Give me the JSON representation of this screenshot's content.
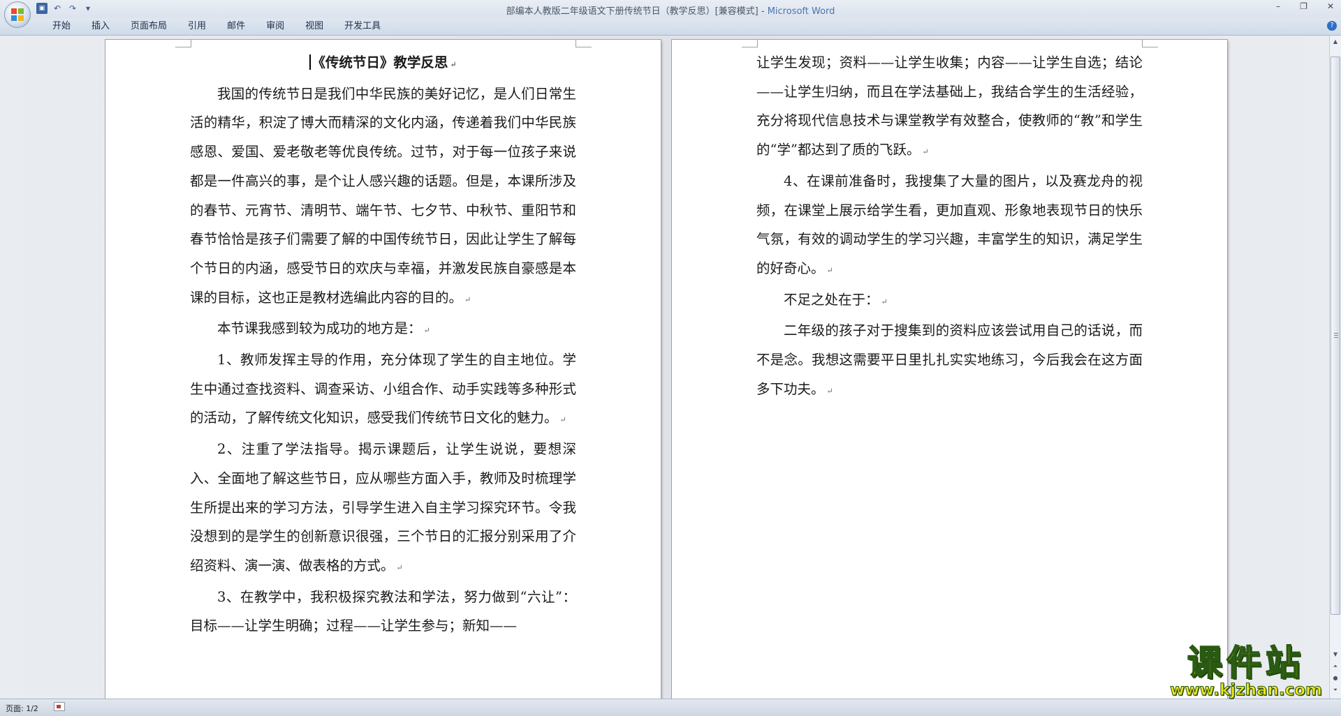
{
  "window": {
    "title_doc": "部编本人教版二年级语文下册传统节日（教学反思）[兼容模式]",
    "title_sep": " - ",
    "title_app": "Microsoft Word",
    "ctrl_min": "–",
    "ctrl_max": "❐",
    "ctrl_close": "✕"
  },
  "quick_access": {
    "save_icon": "save-icon",
    "undo_icon": "undo-icon",
    "redo_icon": "redo-icon",
    "customize_icon": "customize-icon"
  },
  "ribbon": {
    "tabs": [
      "开始",
      "插入",
      "页面布局",
      "引用",
      "邮件",
      "审阅",
      "视图",
      "开发工具"
    ],
    "help": "?"
  },
  "document": {
    "title": "《传统节日》教学反思",
    "page1_paragraphs": [
      "我国的传统节日是我们中华民族的美好记忆，是人们日常生活的精华，积淀了博大而精深的文化内涵，传递着我们中华民族感恩、爱国、爱老敬老等优良传统。过节，对于每一位孩子来说都是一件高兴的事，是个让人感兴趣的话题。但是，本课所涉及的春节、元宵节、清明节、端午节、七夕节、中秋节、重阳节和春节恰恰是孩子们需要了解的中国传统节日，因此让学生了解每个节日的内涵，感受节日的欢庆与幸福，并激发民族自豪感是本课的目标，这也正是教材选编此内容的目的。",
      "本节课我感到较为成功的地方是：",
      "1、教师发挥主导的作用，充分体现了学生的自主地位。学生中通过查找资料、调查采访、小组合作、动手实践等多种形式的活动，了解传统文化知识，感受我们传统节日文化的魅力。",
      "2、注重了学法指导。揭示课题后，让学生说说，要想深入、全面地了解这些节日，应从哪些方面入手，教师及时梳理学生所提出来的学习方法，引导学生进入自主学习探究环节。令我没想到的是学生的创新意识很强，三个节日的汇报分别采用了介绍资料、演一演、做表格的方式。",
      "3、在教学中，我积极探究教法和学法，努力做到“六让”：目标——让学生明确；过程——让学生参与；新知——"
    ],
    "page2_continuation": "让学生发现；资料——让学生收集；内容——让学生自选；结论——让学生归纳，而且在学法基础上，我结合学生的生活经验，充分将现代信息技术与课堂教学有效整合，使教师的“教”和学生的“学”都达到了质的飞跃。",
    "page2_paragraphs": [
      "4、在课前准备时，我搜集了大量的图片，以及赛龙舟的视频，在课堂上展示给学生看，更加直观、形象地表现节日的快乐气氛，有效的调动学生的学习兴趣，丰富学生的知识，满足学生的好奇心。",
      "不足之处在于：",
      "二年级的孩子对于搜集到的资料应该尝试用自己的话说，而不是念。我想这需要平日里扎扎实实地练习，今后我会在这方面多下功夫。"
    ],
    "paragraph_mark": "↵"
  },
  "status": {
    "page_info": "页面: 1/2"
  },
  "watermark": {
    "main": "课件站",
    "url": "www.kjzhan.com"
  },
  "colors": {
    "app_accent": "#4a73b5",
    "watermark_yellow": "#f2e51c",
    "watermark_green": "#2a5a12"
  }
}
